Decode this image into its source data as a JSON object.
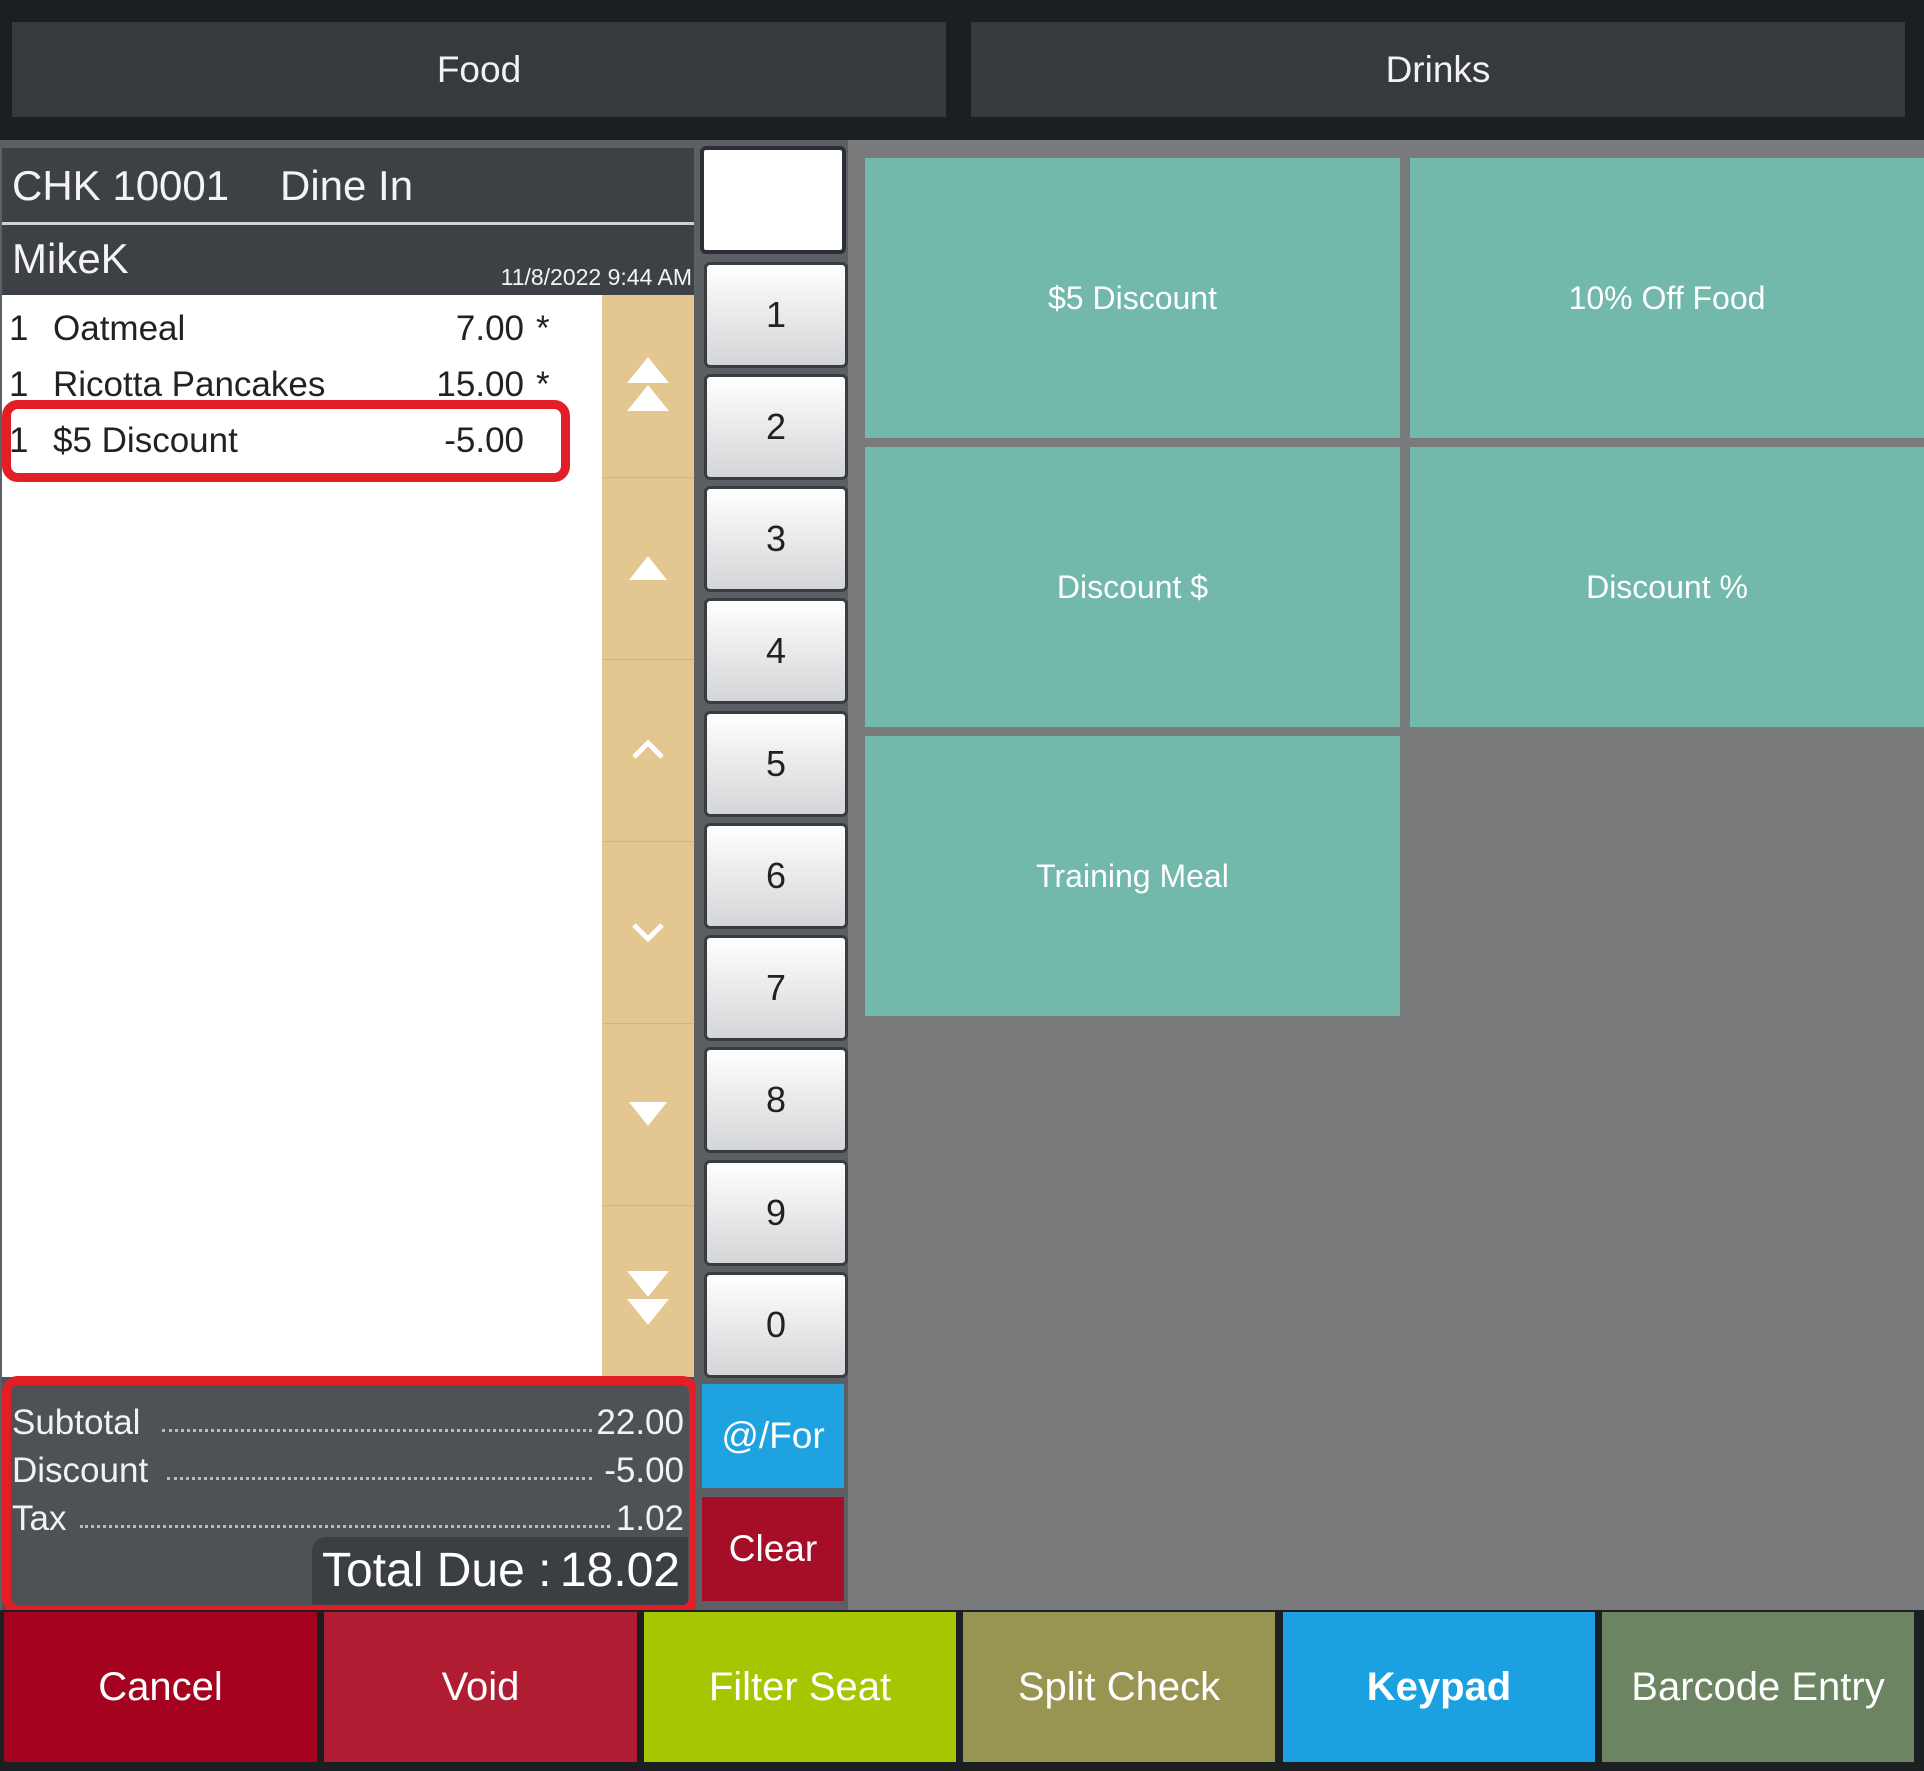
{
  "categories": [
    "Food",
    "Drinks"
  ],
  "check": {
    "number": "CHK 10001",
    "order_type": "Dine In",
    "server": "MikeK",
    "datetime": "11/8/2022 9:44 AM"
  },
  "items": [
    {
      "qty": "1",
      "name": "Oatmeal",
      "price": "7.00",
      "mark": "*"
    },
    {
      "qty": "1",
      "name": "Ricotta Pancakes",
      "price": "15.00",
      "mark": "*"
    },
    {
      "qty": "1",
      "name": "$5 Discount",
      "price": "-5.00",
      "mark": ""
    }
  ],
  "scroll_icons": [
    "double-up-icon",
    "up-icon",
    "chevron-up-icon",
    "chevron-down-icon",
    "down-icon",
    "double-down-icon"
  ],
  "totals": {
    "subtotal_label": "Subtotal",
    "subtotal": "22.00",
    "discount_label": "Discount",
    "discount": "-5.00",
    "tax_label": "Tax",
    "tax": "1.02",
    "total_due_label": "Total Due :",
    "total_due": "18.02"
  },
  "keypad": {
    "display": "",
    "digits": [
      "1",
      "2",
      "3",
      "4",
      "5",
      "6",
      "7",
      "8",
      "9",
      "0"
    ],
    "at_for": "@/For",
    "clear": "Clear"
  },
  "functions": [
    "$5 Discount",
    "10% Off Food",
    "Discount $",
    "Discount %",
    "Training Meal"
  ],
  "actions": [
    "Cancel",
    "Void",
    "Filter Seat",
    "Split Check",
    "Keypad",
    "Barcode Entry"
  ],
  "colors": {
    "function_button": "#72b8ab",
    "highlight": "#e21f26",
    "cancel": "#a5021f",
    "void": "#b01d33",
    "filter_seat": "#a7c602",
    "split_check": "#989452",
    "keypad": "#1ba0e2",
    "barcode_entry": "#6c8462",
    "at_for": "#1ea3e0",
    "clear": "#a50e26"
  }
}
